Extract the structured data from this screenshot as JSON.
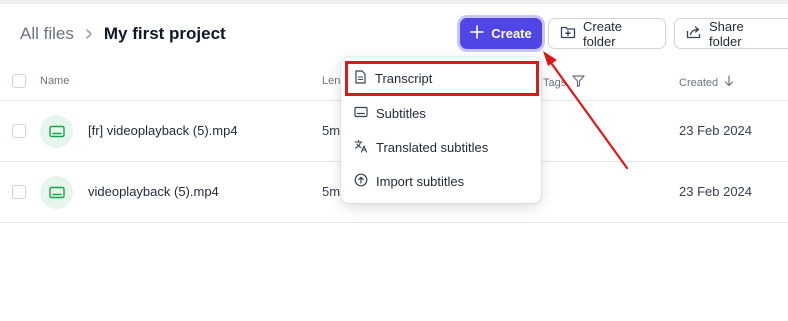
{
  "breadcrumb": {
    "root": "All files",
    "current": "My first project"
  },
  "toolbar": {
    "create_label": "Create",
    "create_folder_label": "Create folder",
    "share_folder_label": "Share folder"
  },
  "table": {
    "columns": {
      "name": "Name",
      "length": "Len",
      "tags": "Tags",
      "created": "Created"
    },
    "rows": [
      {
        "name": "[fr] videoplayback (5).mp4",
        "length": "5m",
        "created": "23 Feb 2024"
      },
      {
        "name": "videoplayback (5).mp4",
        "length": "5m",
        "created": "23 Feb 2024"
      }
    ]
  },
  "create_menu": {
    "items": [
      {
        "label": "Transcript",
        "icon": "document-icon"
      },
      {
        "label": "Subtitles",
        "icon": "subtitles-icon"
      },
      {
        "label": "Translated subtitles",
        "icon": "translate-icon"
      },
      {
        "label": "Import subtitles",
        "icon": "upload-circle-icon"
      }
    ],
    "highlighted_item": "Transcript"
  },
  "colors": {
    "accent": "#4f46e5",
    "annotation": "#d91a1a",
    "file_icon_bg": "#e7f6ec",
    "file_icon": "#16a34a"
  }
}
